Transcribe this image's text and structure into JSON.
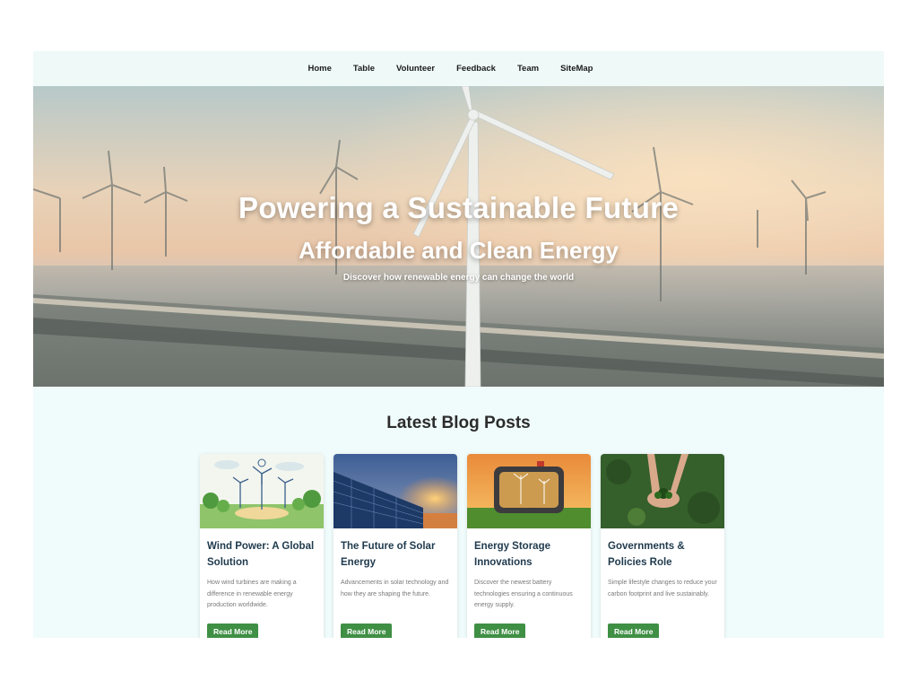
{
  "nav": {
    "items": [
      "Home",
      "Table",
      "Volunteer",
      "Feedback",
      "Team",
      "SiteMap"
    ]
  },
  "hero": {
    "title": "Powering a Sustainable Future",
    "subtitle": "Affordable and Clean Energy",
    "tagline": "Discover how renewable energy can change the world"
  },
  "blog": {
    "heading": "Latest Blog Posts",
    "posts": [
      {
        "title": "Wind Power: A Global Solution",
        "description": "How wind turbines are making a difference in renewable energy production worldwide.",
        "button": "Read More",
        "image": "wind-turbines-illustration"
      },
      {
        "title": "The Future of Solar Energy",
        "description": "Advancements in solar technology and how they are shaping the future.",
        "button": "Read More",
        "image": "solar-panels-sunset"
      },
      {
        "title": "Energy Storage Innovations",
        "description": "Discover the newest battery technologies ensuring a continuous energy supply.",
        "button": "Read More",
        "image": "battery-field-sunset"
      },
      {
        "title": "Governments & Policies Role",
        "description": "Simple lifestyle changes to reduce your carbon footprint and live sustainably.",
        "button": "Read More",
        "image": "hands-holding-plant"
      }
    ]
  },
  "colors": {
    "page_background": "#f0fbfb",
    "button": "#3f8f45",
    "card_title": "#1f3a4d"
  }
}
